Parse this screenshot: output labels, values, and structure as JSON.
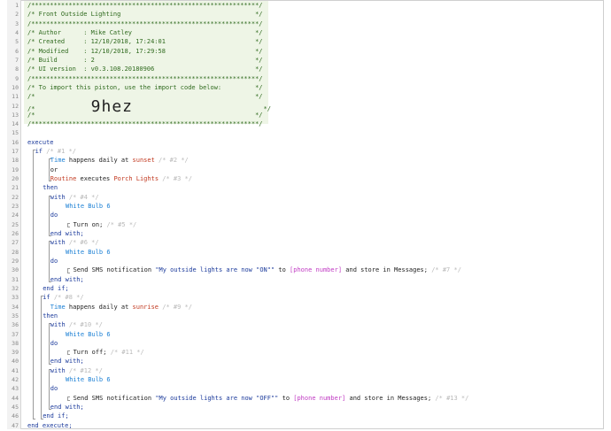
{
  "lines": [
    {
      "num": "1",
      "indent": 0,
      "parts": [
        [
          "cm",
          "/*************************************************************/"
        ]
      ]
    },
    {
      "num": "2",
      "indent": 0,
      "parts": [
        [
          "cm",
          "/* Front Outside Lighting                                    */"
        ]
      ]
    },
    {
      "num": "3",
      "indent": 0,
      "parts": [
        [
          "cm",
          "/*************************************************************/"
        ]
      ]
    },
    {
      "num": "4",
      "indent": 0,
      "parts": [
        [
          "cm",
          "/* Author      : Mike Catley                                 */"
        ]
      ]
    },
    {
      "num": "5",
      "indent": 0,
      "parts": [
        [
          "cm",
          "/* Created     : 12/10/2018, 17:24:01                        */"
        ]
      ]
    },
    {
      "num": "6",
      "indent": 0,
      "parts": [
        [
          "cm",
          "/* Modified    : 12/10/2018, 17:29:58                        */"
        ]
      ]
    },
    {
      "num": "7",
      "indent": 0,
      "parts": [
        [
          "cm",
          "/* Build       : 2                                           */"
        ]
      ]
    },
    {
      "num": "8",
      "indent": 0,
      "parts": [
        [
          "cm",
          "/* UI version  : v0.3.108.20180906                           */"
        ]
      ]
    },
    {
      "num": "9",
      "indent": 0,
      "parts": [
        [
          "cm",
          "/*************************************************************/"
        ]
      ]
    },
    {
      "num": "10",
      "indent": 0,
      "parts": [
        [
          "cm",
          "/* To import this piston, use the import code below:         */"
        ]
      ]
    },
    {
      "num": "11",
      "indent": 0,
      "parts": [
        [
          "cm",
          "/*                                                           */"
        ]
      ]
    },
    {
      "num": "12",
      "indent": 0,
      "parts": [
        [
          "cm",
          "/*               "
        ],
        [
          "big",
          "9hez"
        ],
        [
          "cm",
          "                                   */"
        ]
      ]
    },
    {
      "num": "13",
      "indent": 0,
      "parts": [
        [
          "cm",
          "/*                                                           */"
        ]
      ]
    },
    {
      "num": "14",
      "indent": 0,
      "parts": [
        [
          "cm",
          "/*************************************************************/"
        ]
      ]
    },
    {
      "num": "15",
      "indent": 0,
      "parts": []
    },
    {
      "num": "16",
      "indent": 0,
      "parts": [
        [
          "kw",
          "execute"
        ]
      ]
    },
    {
      "num": "17",
      "indent": 2,
      "parts": [
        [
          "kw",
          "if "
        ],
        [
          "dim",
          "/* #1 */"
        ]
      ]
    },
    {
      "num": "18",
      "indent": 6,
      "parts": [
        [
          "dev",
          "Time"
        ],
        [
          "plain",
          " happens daily at "
        ],
        [
          "val",
          "sunset"
        ],
        [
          "dim",
          " /* #2 */"
        ]
      ]
    },
    {
      "num": "19",
      "indent": 6,
      "parts": [
        [
          "plain",
          "or"
        ]
      ]
    },
    {
      "num": "20",
      "indent": 6,
      "parts": [
        [
          "val",
          "Routine"
        ],
        [
          "plain",
          " executes "
        ],
        [
          "val",
          "Porch Lights"
        ],
        [
          "dim",
          " /* #3 */"
        ]
      ]
    },
    {
      "num": "21",
      "indent": 4,
      "parts": [
        [
          "kw",
          "then"
        ]
      ]
    },
    {
      "num": "22",
      "indent": 6,
      "parts": [
        [
          "kw",
          "with "
        ],
        [
          "dim",
          "/* #4 */"
        ]
      ]
    },
    {
      "num": "23",
      "indent": 10,
      "parts": [
        [
          "dev",
          "White Bulb 6"
        ]
      ]
    },
    {
      "num": "24",
      "indent": 6,
      "parts": [
        [
          "kw",
          "do"
        ]
      ]
    },
    {
      "num": "25",
      "indent": 12,
      "parts": [
        [
          "plain",
          "Turn on; "
        ],
        [
          "dim",
          "/* #5 */"
        ]
      ]
    },
    {
      "num": "26",
      "indent": 6,
      "parts": [
        [
          "kw",
          "end with;"
        ]
      ]
    },
    {
      "num": "27",
      "indent": 6,
      "parts": [
        [
          "kw",
          "with "
        ],
        [
          "dim",
          "/* #6 */"
        ]
      ]
    },
    {
      "num": "28",
      "indent": 10,
      "parts": [
        [
          "dev",
          "White Bulb 6"
        ]
      ]
    },
    {
      "num": "29",
      "indent": 6,
      "parts": [
        [
          "kw",
          "do"
        ]
      ]
    },
    {
      "num": "30",
      "indent": 12,
      "parts": [
        [
          "plain",
          "Send SMS notification "
        ],
        [
          "str",
          "\"My outside lights are now \"ON\"\""
        ],
        [
          "plain",
          " to "
        ],
        [
          "var",
          "[phone number]"
        ],
        [
          "plain",
          " and store in Messages; "
        ],
        [
          "dim",
          "/* #7 */"
        ]
      ]
    },
    {
      "num": "31",
      "indent": 6,
      "parts": [
        [
          "kw",
          "end with;"
        ]
      ]
    },
    {
      "num": "32",
      "indent": 4,
      "parts": [
        [
          "kw",
          "end if;"
        ]
      ]
    },
    {
      "num": "33",
      "indent": 4,
      "parts": [
        [
          "kw",
          "if "
        ],
        [
          "dim",
          "/* #8 */"
        ]
      ]
    },
    {
      "num": "34",
      "indent": 6,
      "parts": [
        [
          "dev",
          "Time"
        ],
        [
          "plain",
          " happens daily at "
        ],
        [
          "val",
          "sunrise"
        ],
        [
          "dim",
          " /* #9 */"
        ]
      ]
    },
    {
      "num": "35",
      "indent": 4,
      "parts": [
        [
          "kw",
          "then"
        ]
      ]
    },
    {
      "num": "36",
      "indent": 6,
      "parts": [
        [
          "kw",
          "with "
        ],
        [
          "dim",
          "/* #10 */"
        ]
      ]
    },
    {
      "num": "37",
      "indent": 10,
      "parts": [
        [
          "dev",
          "White Bulb 6"
        ]
      ]
    },
    {
      "num": "38",
      "indent": 6,
      "parts": [
        [
          "kw",
          "do"
        ]
      ]
    },
    {
      "num": "39",
      "indent": 12,
      "parts": [
        [
          "plain",
          "Turn off; "
        ],
        [
          "dim",
          "/* #11 */"
        ]
      ]
    },
    {
      "num": "40",
      "indent": 6,
      "parts": [
        [
          "kw",
          "end with;"
        ]
      ]
    },
    {
      "num": "41",
      "indent": 6,
      "parts": [
        [
          "kw",
          "with "
        ],
        [
          "dim",
          "/* #12 */"
        ]
      ]
    },
    {
      "num": "42",
      "indent": 10,
      "parts": [
        [
          "dev",
          "White Bulb 6"
        ]
      ]
    },
    {
      "num": "43",
      "indent": 6,
      "parts": [
        [
          "kw",
          "do"
        ]
      ]
    },
    {
      "num": "44",
      "indent": 12,
      "parts": [
        [
          "plain",
          "Send SMS notification "
        ],
        [
          "str",
          "\"My outside lights are now \"OFF\"\""
        ],
        [
          "plain",
          " to "
        ],
        [
          "var",
          "[phone number]"
        ],
        [
          "plain",
          " and store in Messages; "
        ],
        [
          "dim",
          "/* #13 */"
        ]
      ]
    },
    {
      "num": "45",
      "indent": 6,
      "parts": [
        [
          "kw",
          "end with;"
        ]
      ]
    },
    {
      "num": "46",
      "indent": 4,
      "parts": [
        [
          "kw",
          "end if;"
        ]
      ]
    },
    {
      "num": "47",
      "indent": 0,
      "parts": [
        [
          "kw",
          "end execute;"
        ]
      ]
    }
  ]
}
